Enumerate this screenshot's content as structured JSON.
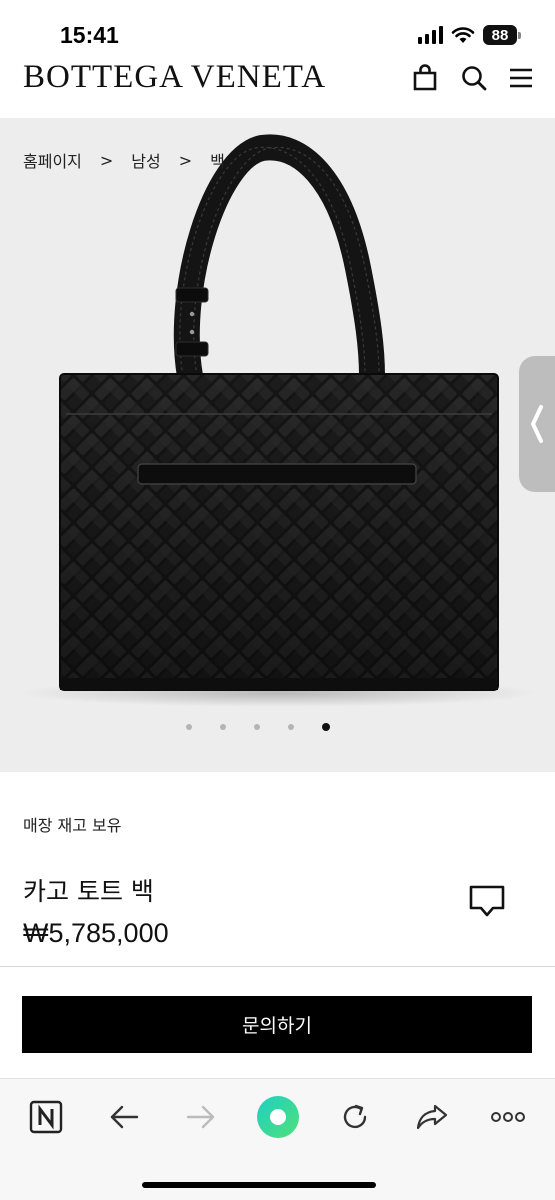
{
  "status": {
    "time": "15:41",
    "battery": "88"
  },
  "header": {
    "brand": "BOTTEGA VENETA",
    "icons": [
      "shopping-bag-icon",
      "search-icon",
      "menu-icon"
    ]
  },
  "breadcrumb": {
    "items": [
      "홈페이지",
      "남성",
      "백"
    ],
    "separator": ">"
  },
  "gallery": {
    "slide_count": 5,
    "active_index": 4
  },
  "product": {
    "stock": "매장 재고 보유",
    "name": "카고 토트 백",
    "price": "₩5,785,000"
  },
  "actions": {
    "inquire_label": "문의하기"
  },
  "browser_toolbar": {
    "buttons": [
      "naver-icon",
      "back-arrow-icon",
      "forward-arrow-icon",
      "green-dot-icon",
      "reload-icon",
      "share-icon",
      "more-icon"
    ]
  },
  "colors": {
    "accent": "#000000",
    "gallery_bg": "#ededed",
    "assistant": "#3ed68a"
  }
}
